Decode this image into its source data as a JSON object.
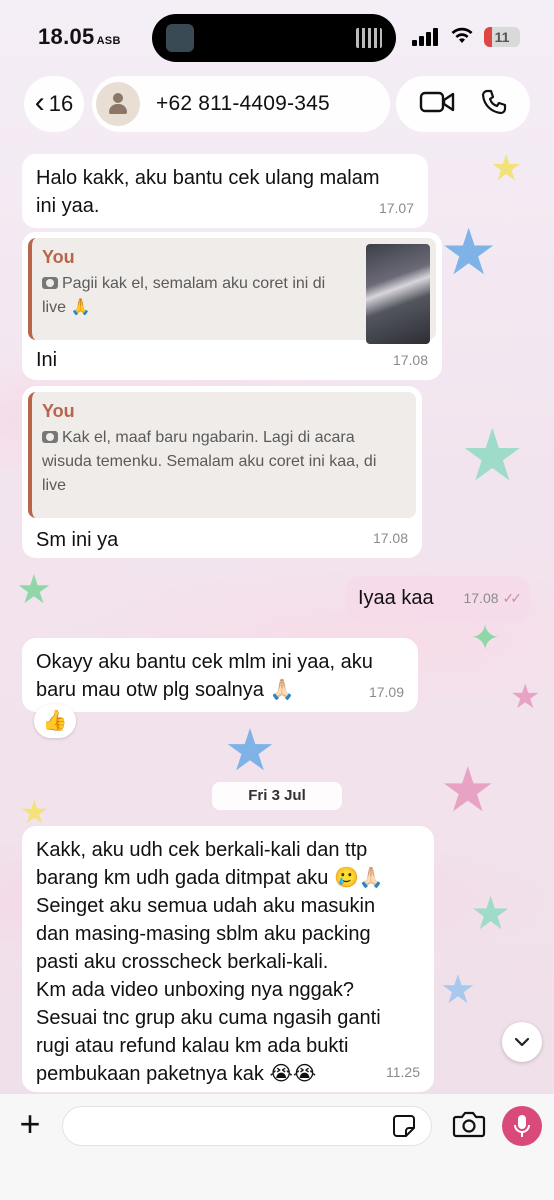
{
  "status_bar": {
    "time": "18.05",
    "time_badge": "ASB",
    "battery": "11"
  },
  "header": {
    "back_count": "16",
    "contact_name": "+62 811-4409-345",
    "icons": {
      "back": "chevron-left-icon",
      "avatar": "person-icon",
      "video": "video-camera-icon",
      "call": "phone-icon"
    }
  },
  "messages": [
    {
      "direction": "in",
      "text_line1": "Halo kakk, aku bantu cek ulang malam",
      "text_line2": "ini yaa.",
      "time": "17.07"
    },
    {
      "direction": "in",
      "quote_author": "You",
      "quote_line1": "Pagii kak el, semalam aku coret ini di",
      "quote_line2": "live 🙏",
      "text": "Ini",
      "time": "17.08"
    },
    {
      "direction": "in",
      "quote_author": "You",
      "quote_line1": "Kak el, maaf baru ngabarin. Lagi di acara",
      "quote_line2": "wisuda temenku. Semalam aku coret ini kaa, di",
      "quote_line3": "live",
      "text": "Sm ini ya",
      "time": "17.08"
    },
    {
      "direction": "out",
      "text": "Iyaa kaa",
      "time": "17.08",
      "ticks": "✓✓"
    },
    {
      "direction": "in",
      "text_line1": "Okayy aku bantu cek mlm ini yaa, aku",
      "text_line2": "baru mau otw plg soalnya 🙏🏻",
      "time": "17.09",
      "reaction": "👍"
    },
    {
      "direction": "in",
      "lines": [
        "Kakk, aku udh cek berkali-kali dan ttp",
        "barang km udh gada ditmpat aku 🥲🙏🏻",
        "Seinget aku semua udah aku masukin",
        "dan masing-masing sblm aku packing",
        "pasti aku crosscheck berkali-kali.",
        "Km ada video unboxing nya nggak?",
        "Sesuai tnc grup aku cuma ngasih ganti",
        "rugi atau refund kalau km ada bukti",
        "pembukaan paketnya kak 😭😭"
      ],
      "time": "11.25"
    }
  ],
  "date_separator": "Fri 3 Jul",
  "composer": {
    "placeholder": "",
    "icons": {
      "attach": "plus-icon",
      "sticker": "sticker-icon",
      "camera": "camera-icon",
      "mic": "microphone-icon"
    }
  },
  "colors": {
    "accent": "#d9497a",
    "quote_author": "#b8654a",
    "outgoing_bubble": "#f6dcea"
  }
}
